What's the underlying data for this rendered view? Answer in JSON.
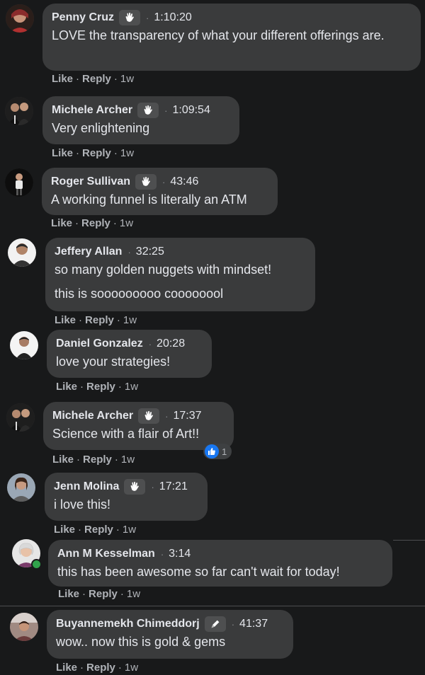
{
  "actions": {
    "like_label": "Like",
    "reply_label": "Reply",
    "dot": "·"
  },
  "comments": [
    {
      "name": "Penny Cruz",
      "badge": "wave",
      "time": "1:10:20",
      "text": "LOVE the transparency of what your different offerings are.",
      "age": "1w"
    },
    {
      "name": "Michele Archer",
      "badge": "wave",
      "time": "1:09:54",
      "text": "Very enlightening",
      "age": "1w"
    },
    {
      "name": "Roger Sullivan",
      "badge": "wave",
      "time": "43:46",
      "text": "A working funnel is literally an ATM",
      "age": "1w"
    },
    {
      "name": "Jeffery Allan",
      "badge": "",
      "time": "32:25",
      "text": "so many golden nuggets with mindset!",
      "text2": "this is sooooooooo coooooool",
      "age": "1w"
    },
    {
      "name": "Daniel Gonzalez",
      "badge": "",
      "time": "20:28",
      "text": "love your strategies!",
      "age": "1w"
    },
    {
      "name": "Michele Archer",
      "badge": "wave",
      "time": "17:37",
      "text": "Science with a flair of Art!!",
      "age": "1w",
      "reaction_count": "1"
    },
    {
      "name": "Jenn Molina",
      "badge": "wave",
      "time": "17:21",
      "text": "i love this!",
      "age": "1w"
    },
    {
      "name": "Ann M Kesselman",
      "badge": "",
      "time": "3:14",
      "text": "this has been awesome so far can't wait for today!",
      "age": "1w"
    },
    {
      "name": "Buyannemekh Chimeddorj",
      "badge": "pen",
      "time": "41:37",
      "text": "wow.. now this is gold & gems",
      "age": "1w"
    }
  ],
  "colors": {
    "background": "#18191a",
    "bubble": "#3a3b3c",
    "like_blue": "#1877f2",
    "online_green": "#31a24c"
  }
}
